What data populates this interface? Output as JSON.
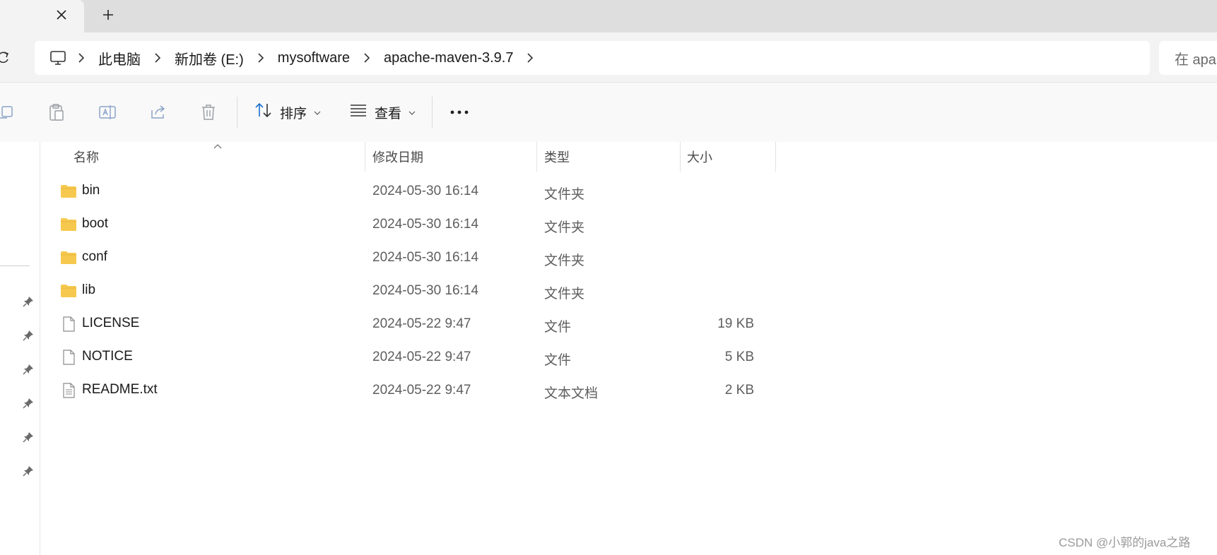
{
  "tabs": {
    "close_icon": "close-icon",
    "new_tab_icon": "plus-icon"
  },
  "address": {
    "breadcrumbs": [
      "此电脑",
      "新加卷 (E:)",
      "mysoftware",
      "apache-maven-3.9.7"
    ],
    "search_placeholder": "在 apa"
  },
  "toolbar": {
    "sort_label": "排序",
    "view_label": "查看"
  },
  "columns": {
    "name": "名称",
    "modified": "修改日期",
    "type": "类型",
    "size": "大小"
  },
  "files": [
    {
      "name": "bin",
      "modified": "2024-05-30 16:14",
      "type": "文件夹",
      "size": "",
      "kind": "folder"
    },
    {
      "name": "boot",
      "modified": "2024-05-30 16:14",
      "type": "文件夹",
      "size": "",
      "kind": "folder"
    },
    {
      "name": "conf",
      "modified": "2024-05-30 16:14",
      "type": "文件夹",
      "size": "",
      "kind": "folder"
    },
    {
      "name": "lib",
      "modified": "2024-05-30 16:14",
      "type": "文件夹",
      "size": "",
      "kind": "folder"
    },
    {
      "name": "LICENSE",
      "modified": "2024-05-22 9:47",
      "type": "文件",
      "size": "19 KB",
      "kind": "file"
    },
    {
      "name": "NOTICE",
      "modified": "2024-05-22 9:47",
      "type": "文件",
      "size": "5 KB",
      "kind": "file"
    },
    {
      "name": "README.txt",
      "modified": "2024-05-22 9:47",
      "type": "文本文档",
      "size": "2 KB",
      "kind": "text"
    }
  ],
  "watermark": "CSDN @小郭的java之路",
  "colors": {
    "folder": "#f6c94e",
    "accent": "#1a6fd1"
  }
}
